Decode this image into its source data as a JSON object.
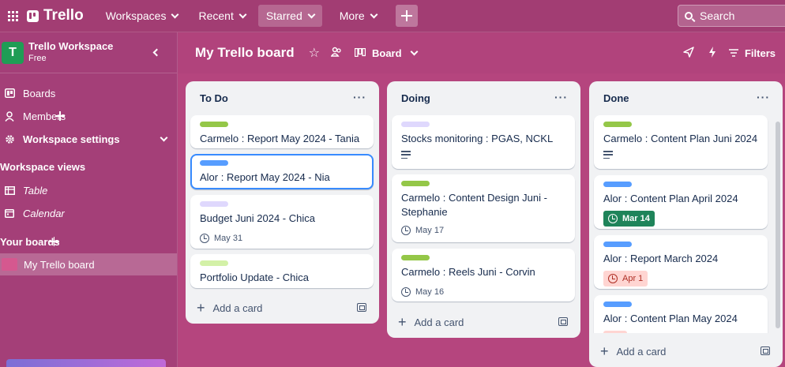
{
  "topnav": {
    "logo_text": "Trello",
    "menus": [
      "Workspaces",
      "Recent",
      "Starred",
      "More"
    ],
    "search_placeholder": "Search"
  },
  "sidebar": {
    "workspace_initial": "T",
    "workspace_name": "Trello Workspace",
    "workspace_plan": "Free",
    "items": [
      {
        "label": "Boards"
      },
      {
        "label": "Members"
      },
      {
        "label": "Workspace settings"
      }
    ],
    "views_title": "Workspace views",
    "views": [
      {
        "label": "Table"
      },
      {
        "label": "Calendar"
      }
    ],
    "boards_title": "Your boards",
    "boards": [
      {
        "label": "My Trello board"
      }
    ]
  },
  "board": {
    "title": "My Trello board",
    "view_label": "Board",
    "filters_label": "Filters"
  },
  "lists": [
    {
      "title": "To Do",
      "add_label": "Add a card",
      "cards": [
        {
          "title": "Carmelo : Report May 2024 - Tania",
          "label_color": "#94c748"
        },
        {
          "title": "Alor : Report May 2024 - Nia",
          "label_color": "#579dff"
        },
        {
          "title": "Budget Juni 2024 - Chica",
          "label_color": "#dfd8fd",
          "due": "May 31"
        },
        {
          "title": "Portfolio Update - Chica",
          "label_color": "#d3f1a7"
        }
      ]
    },
    {
      "title": "Doing",
      "add_label": "Add a card",
      "cards": [
        {
          "title": "Stocks monitoring : PGAS, NCKL",
          "label_color": "#dfd8fd"
        },
        {
          "title": "Carmelo : Content Design Juni - Stephanie",
          "label_color": "#94c748",
          "due": "May 17"
        },
        {
          "title": "Carmelo : Reels Juni - Corvin",
          "label_color": "#94c748",
          "due": "May 16"
        }
      ]
    },
    {
      "title": "Done",
      "add_label": "Add a card",
      "cards": [
        {
          "title": "Carmelo : Content Plan Juni 2024",
          "label_color": "#94c748"
        },
        {
          "title": "Alor : Content Plan April 2024",
          "label_color": "#579dff",
          "due": "Mar 14"
        },
        {
          "title": "Alor : Report March 2024",
          "label_color": "#579dff",
          "due": "Apr 1"
        },
        {
          "title": "Alor : Content Plan May 2024",
          "label_color": "#579dff"
        }
      ]
    }
  ]
}
